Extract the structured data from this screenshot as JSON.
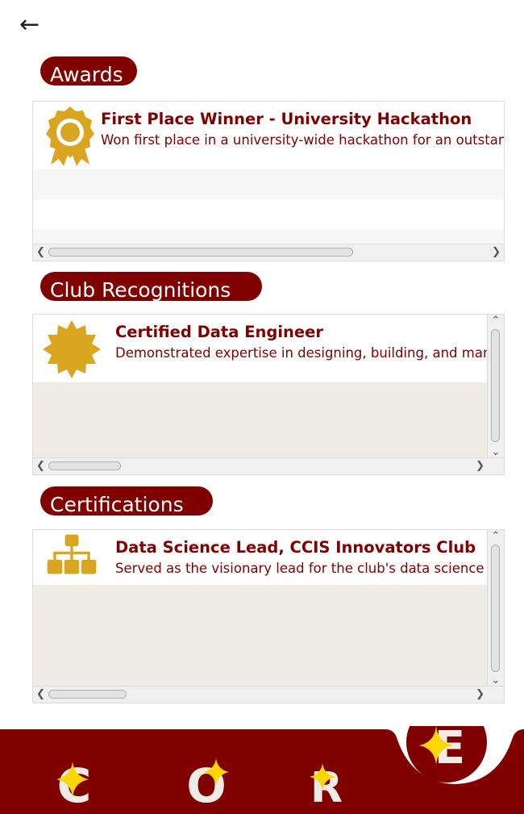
{
  "back_icon": "left-arrow-icon",
  "sections": {
    "awards": {
      "heading": "Awards",
      "item": {
        "icon": "award-badge-icon",
        "title": "First Place Winner - University Hackathon",
        "description": "Won first place in a university-wide hackathon for an outstanding"
      }
    },
    "club": {
      "heading": "Club Recognitions",
      "item": {
        "icon": "seal-badge-icon",
        "title": "Certified Data Engineer",
        "description": "Demonstrated expertise in designing, building, and managing"
      }
    },
    "certs": {
      "heading": "Certifications",
      "item": {
        "icon": "org-chart-icon",
        "title": "Data Science Lead, CCIS Innovators Club",
        "description": "Served as the visionary lead for the club's data science division"
      }
    }
  },
  "bottom_nav": {
    "items": [
      {
        "letter": "C"
      },
      {
        "letter": "O"
      },
      {
        "letter": "R"
      },
      {
        "letter": "E",
        "active": true
      }
    ]
  },
  "colors": {
    "brand": "#800000",
    "gold": "#DAA520",
    "panel_bg": "#EFEBE5"
  }
}
